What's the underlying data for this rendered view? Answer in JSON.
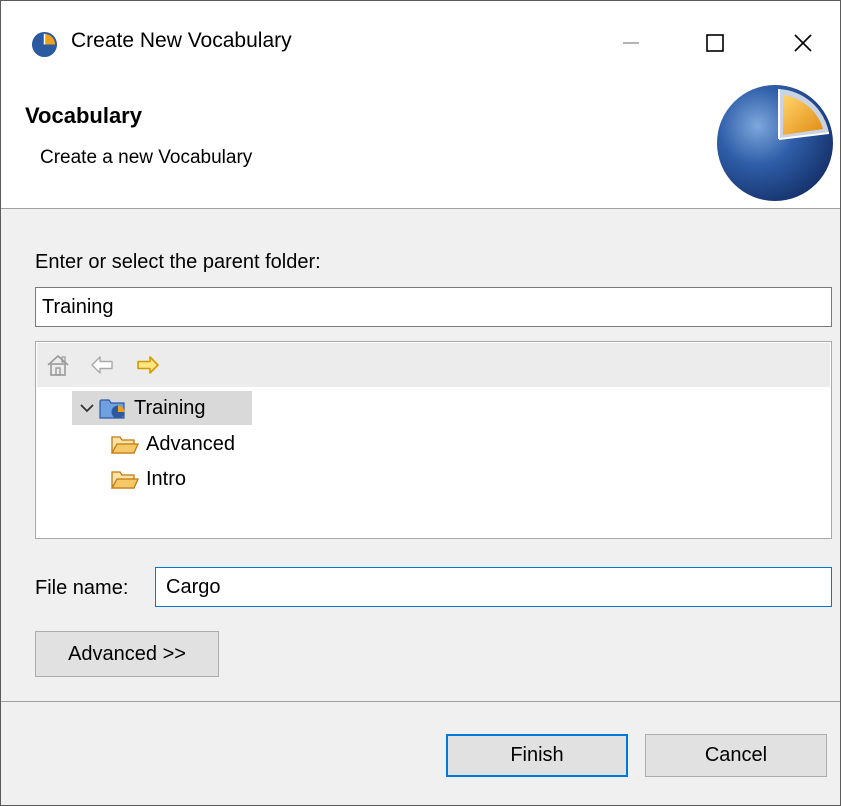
{
  "window": {
    "title": "Create New Vocabulary",
    "icon": "vocabulary-pie-icon",
    "controls": [
      "minimize-icon",
      "maximize-icon",
      "close-icon"
    ]
  },
  "banner": {
    "title": "Vocabulary",
    "message": "Create a new Vocabulary",
    "logo": "vocabulary-pie-logo"
  },
  "parent_folder": {
    "label": "Enter or select the parent folder:",
    "value": "Training"
  },
  "tree": {
    "toolbar": [
      "home-icon",
      "back-arrow-icon",
      "forward-arrow-icon"
    ],
    "items": [
      {
        "label": "Training",
        "icon": "project-folder-icon",
        "expanded": true,
        "selected": true
      },
      {
        "label": "Advanced",
        "icon": "folder-icon"
      },
      {
        "label": "Intro",
        "icon": "folder-icon"
      }
    ]
  },
  "file_name": {
    "label": "File name:",
    "value": "Cargo"
  },
  "buttons": {
    "advanced": "Advanced >>",
    "finish": "Finish",
    "cancel": "Cancel"
  },
  "colors": {
    "accent": "#0078d7",
    "selection": "#d9d9d9",
    "folder": "#e8a33d",
    "logo_blue": "#2c5aa0",
    "logo_orange": "#f0a020"
  }
}
